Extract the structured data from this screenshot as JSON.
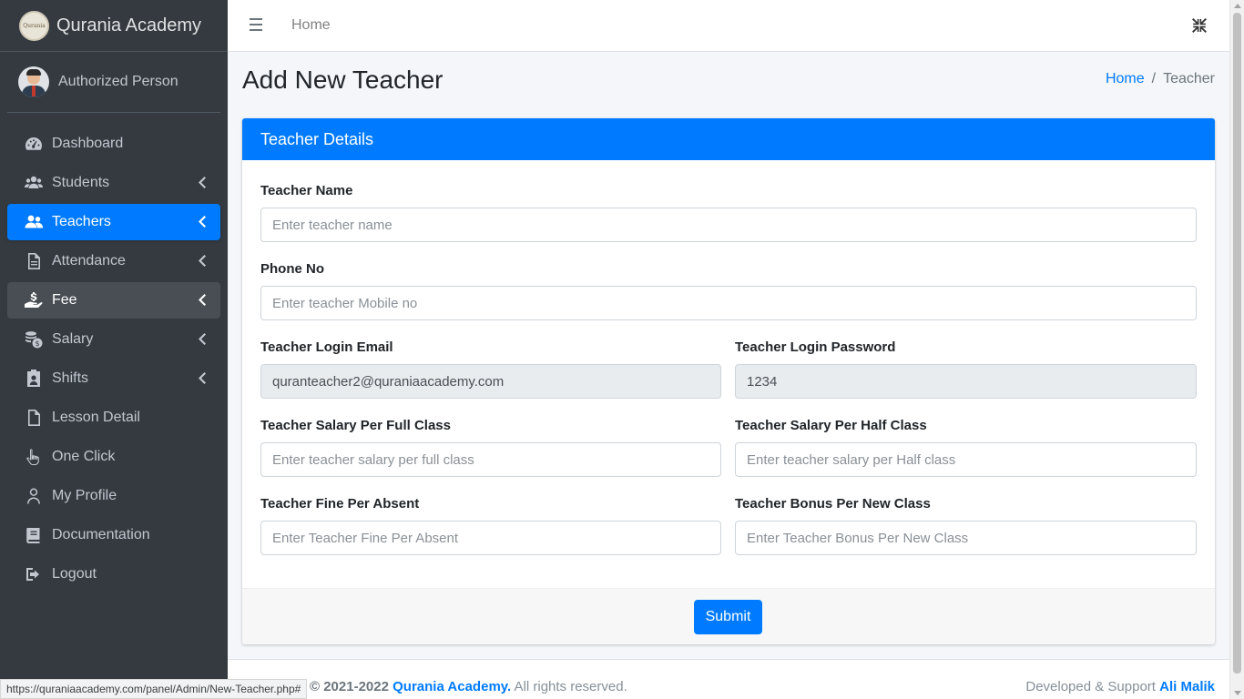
{
  "brand": {
    "name": "Qurania Academy",
    "logo_text": "Qurania"
  },
  "user": {
    "name": "Authorized Person"
  },
  "sidebar": {
    "items": [
      {
        "label": "Dashboard",
        "icon": "tachometer-icon"
      },
      {
        "label": "Students",
        "icon": "users-icon"
      },
      {
        "label": "Teachers",
        "icon": "user-friends-icon"
      },
      {
        "label": "Attendance",
        "icon": "file-alt-icon"
      },
      {
        "label": "Fee",
        "icon": "hand-holding-usd-icon"
      },
      {
        "label": "Salary",
        "icon": "coins-icon"
      },
      {
        "label": "Shifts",
        "icon": "id-badge-icon"
      },
      {
        "label": "Lesson Detail",
        "icon": "file-icon"
      },
      {
        "label": "One Click",
        "icon": "hand-pointer-icon"
      },
      {
        "label": "My Profile",
        "icon": "user-icon"
      },
      {
        "label": "Documentation",
        "icon": "book-icon"
      },
      {
        "label": "Logout",
        "icon": "sign-out-icon"
      }
    ],
    "active": "Teachers"
  },
  "topbar": {
    "home": "Home"
  },
  "page": {
    "title": "Add New Teacher",
    "breadcrumb": {
      "home": "Home",
      "current": "Teacher"
    }
  },
  "form": {
    "header": "Teacher Details",
    "teacher_name": {
      "label": "Teacher Name",
      "placeholder": "Enter teacher name"
    },
    "phone": {
      "label": "Phone No",
      "placeholder": "Enter teacher Mobile no"
    },
    "email": {
      "label": "Teacher Login Email",
      "value": "quranteacher2@quraniaacademy.com"
    },
    "password": {
      "label": "Teacher Login Password",
      "value": "1234"
    },
    "salary_full": {
      "label": "Teacher Salary Per Full Class",
      "placeholder": "Enter teacher salary per full class"
    },
    "salary_half": {
      "label": "Teacher Salary Per Half Class",
      "placeholder": "Enter teacher salary per Half class"
    },
    "fine": {
      "label": "Teacher Fine Per Absent",
      "placeholder": "Enter Teacher Fine Per Absent"
    },
    "bonus": {
      "label": "Teacher Bonus Per New Class",
      "placeholder": "Enter Teacher Bonus Per New Class"
    },
    "submit": "Submit"
  },
  "footer": {
    "copyright_prefix": "© 2021-2022",
    "academy": "Qurania Academy.",
    "rights": "All rights reserved.",
    "dev_prefix": "Developed & Support",
    "dev_name": "Ali Malik"
  },
  "status_url": "https://quraniaacademy.com/panel/Admin/New-Teacher.php#",
  "colors": {
    "primary": "#007bff",
    "sidebar": "#343a40"
  }
}
